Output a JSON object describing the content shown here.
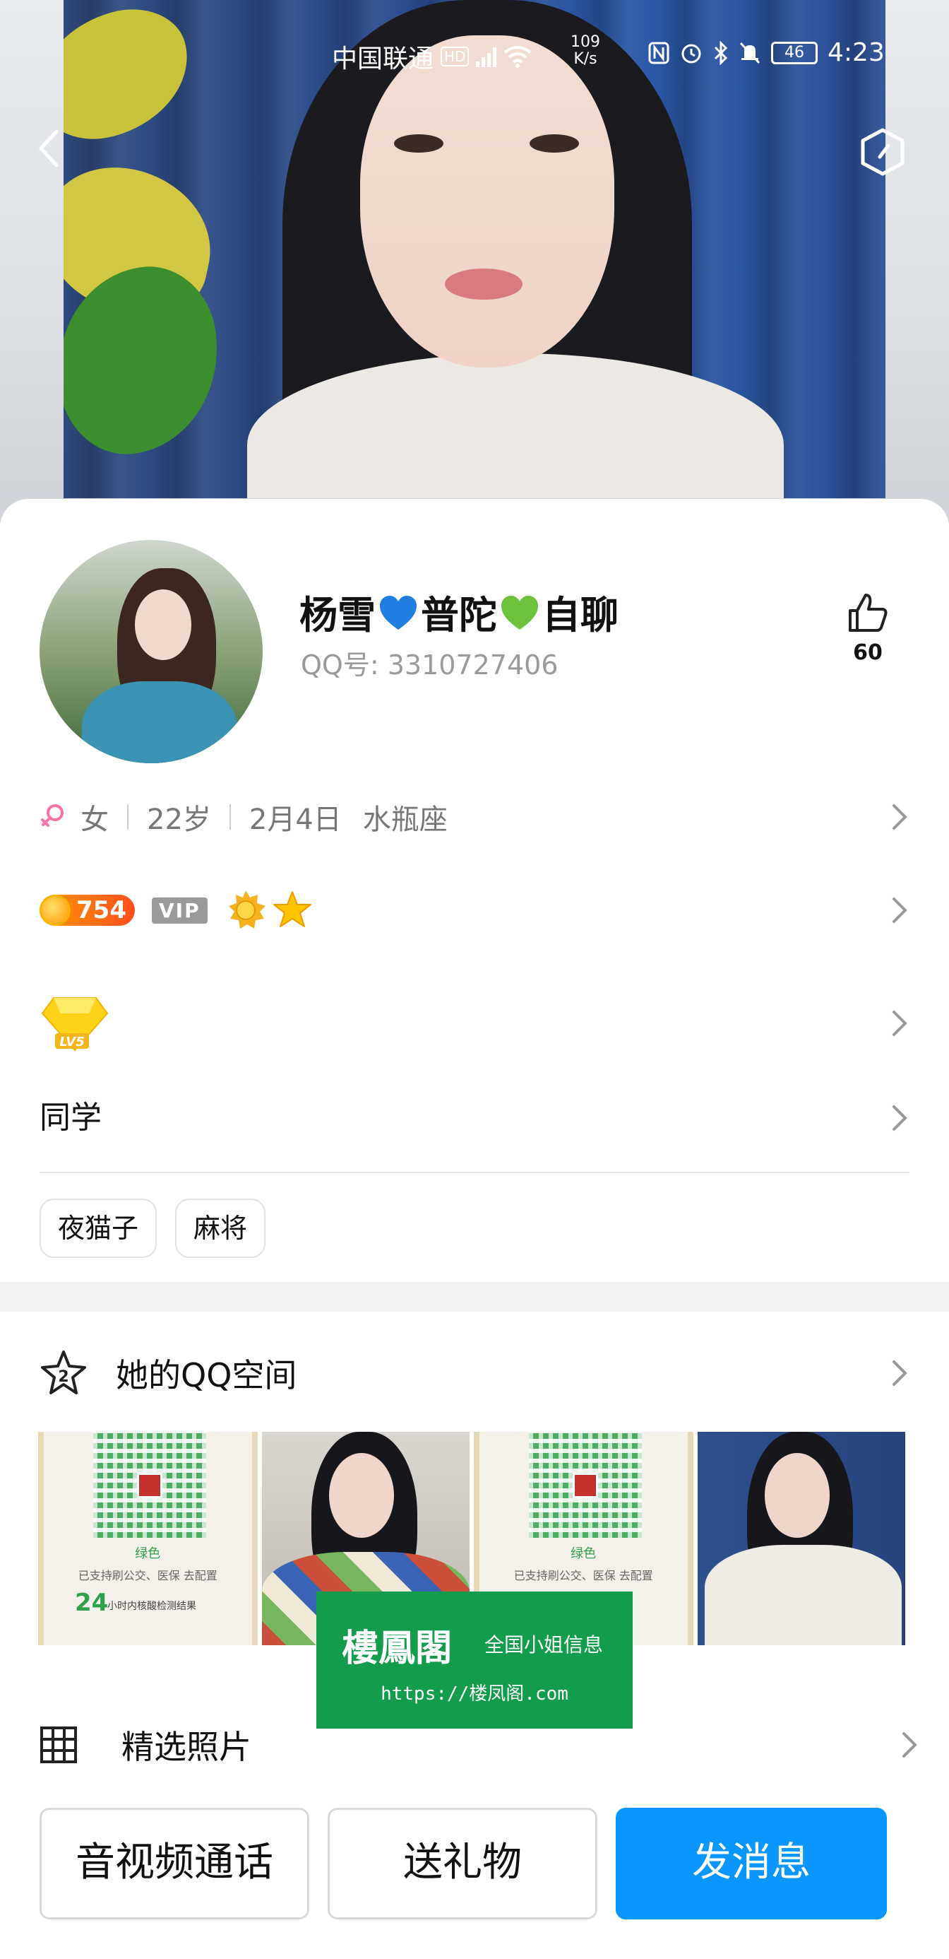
{
  "status_bar": {
    "carrier": "中国联通",
    "hd": "HD",
    "network_speed_value": "109",
    "network_speed_unit": "K/s",
    "battery": "46",
    "time": "4:23"
  },
  "profile": {
    "nickname_part1": "杨雪",
    "nickname_part2": "普陀",
    "nickname_part3": "自聊",
    "qq_label": "QQ号:",
    "qq_number": "3310727406",
    "likes": "60"
  },
  "basic_info": {
    "gender": "女",
    "age": "22岁",
    "birthday": "2月4日",
    "zodiac": "水瓶座"
  },
  "badges": {
    "coin_count": "754",
    "vip": "VIP"
  },
  "relation": "同学",
  "tags": [
    "夜猫子",
    "麻将"
  ],
  "qzone": {
    "label": "她的QQ空间"
  },
  "qr_card": {
    "color_label": "绿色",
    "support_text": "已支持刷公交、医保",
    "config_tag": "去配置",
    "hours": "24",
    "hours_text": "小时内核酸检测结果"
  },
  "watermark": {
    "title": "樓鳳閣",
    "subtitle": "全国小姐信息",
    "url": "https://楼凤阁.com"
  },
  "featured": {
    "label": "精选照片"
  },
  "actions": {
    "call": "音视频通话",
    "gift": "送礼物",
    "message": "发消息"
  },
  "colors": {
    "primary": "#0a96ff",
    "watermark_green": "#129c4b",
    "gender_female": "#ff6fa9"
  }
}
